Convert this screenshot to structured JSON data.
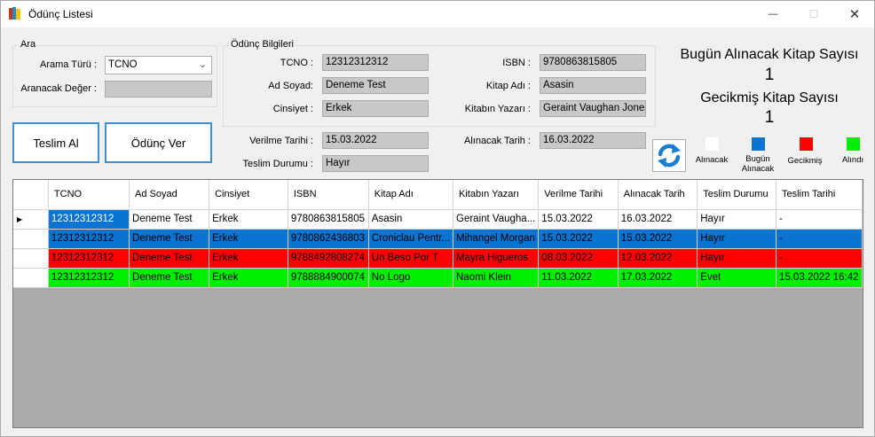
{
  "window": {
    "title": "Ödünç Listesi",
    "minimize": "—",
    "maximize": "☐",
    "close": "✕"
  },
  "search": {
    "group_title": "Ara",
    "type_label": "Arama Türü :",
    "type_value": "TCNO",
    "value_label": "Aranacak Değer :",
    "value": ""
  },
  "details": {
    "group_title": "Ödünç Bilgileri",
    "tcno_label": "TCNO :",
    "tcno": "12312312312",
    "name_label": "Ad Soyad:",
    "name": "Deneme Test",
    "gender_label": "Cinsiyet :",
    "gender": "Erkek",
    "isbn_label": "ISBN :",
    "isbn": "9780863815805",
    "book_label": "Kitap Adı :",
    "book": "Asasin",
    "author_label": "Kitabın Yazarı :",
    "author": "Geraint Vaughan Jones",
    "given_date_label": "Verilme Tarihi :",
    "given_date": "15.03.2022",
    "due_date_label": "Alınacak Tarih :",
    "due_date": "16.03.2022",
    "return_status_label": "Teslim Durumu :",
    "return_status": "Hayır"
  },
  "buttons": {
    "receive": "Teslim Al",
    "lend": "Ödünç Ver"
  },
  "stats": {
    "today_label": "Bugün Alınacak Kitap Sayısı",
    "today_count": "1",
    "late_label": "Gecikmiş Kitap Sayısı",
    "late_count": "1"
  },
  "legend": [
    {
      "label": "Alınacak",
      "color": "#ffffff"
    },
    {
      "label": "Bugün Alınacak",
      "color": "#0b73d2"
    },
    {
      "label": "Gecikmiş",
      "color": "#ff0000"
    },
    {
      "label": "Alındı",
      "color": "#00ee00"
    }
  ],
  "table": {
    "headers": [
      "TCNO",
      "Ad Soyad",
      "Cinsiyet",
      "ISBN",
      "Kitap Adı",
      "Kitabın Yazarı",
      "Verilme Tarihi",
      "Alınacak Tarih",
      "Teslim Durumu",
      "Teslim Tarihi"
    ],
    "rows": [
      {
        "color": "#ffffff",
        "cells": [
          "12312312312",
          "Deneme Test",
          "Erkek",
          "9780863815805",
          "Asasin",
          "Geraint Vaugha...",
          "15.03.2022",
          "16.03.2022",
          "Hayır",
          "-"
        ]
      },
      {
        "color": "#0b73d2",
        "cells": [
          "12312312312",
          "Deneme Test",
          "Erkek",
          "9780862436803",
          "Croniclau Pentr...",
          "Mihangel Morgan",
          "15.03.2022",
          "15.03.2022",
          "Hayır",
          "-"
        ]
      },
      {
        "color": "#ff0000",
        "cells": [
          "12312312312",
          "Deneme Test",
          "Erkek",
          "9788492808274",
          "Un Beso Por T",
          "Mayra Higueros",
          "08.03.2022",
          "12.03.2022",
          "Hayır",
          "-"
        ]
      },
      {
        "color": "#00ee00",
        "cells": [
          "12312312312",
          "Deneme Test",
          "Erkek",
          "9788884900074",
          "No Logo",
          "Naomi Klein",
          "11.03.2022",
          "17.03.2022",
          "Evet",
          "15.03.2022 16:42"
        ]
      }
    ]
  }
}
